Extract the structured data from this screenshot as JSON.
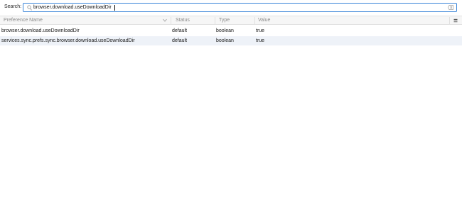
{
  "search": {
    "label": "Search:",
    "value": "browser.download.useDownloadDir"
  },
  "columns": {
    "name": "Preference Name",
    "status": "Status",
    "type": "Type",
    "value": "Value"
  },
  "rows": [
    {
      "name": "browser.download.useDownloadDir",
      "status": "default",
      "type": "boolean",
      "value": "true"
    },
    {
      "name": "services.sync.prefs.sync.browser.download.useDownloadDir",
      "status": "default",
      "type": "boolean",
      "value": "true"
    }
  ],
  "icons": {
    "search": "search-icon",
    "clear": "clear-icon",
    "sort": "sort-descending-icon",
    "column_picker": "column-picker-icon"
  },
  "colors": {
    "focus_border": "#3a85d8",
    "header_bg": "#f6f6f6",
    "alt_row_bg": "#eef2f8"
  }
}
